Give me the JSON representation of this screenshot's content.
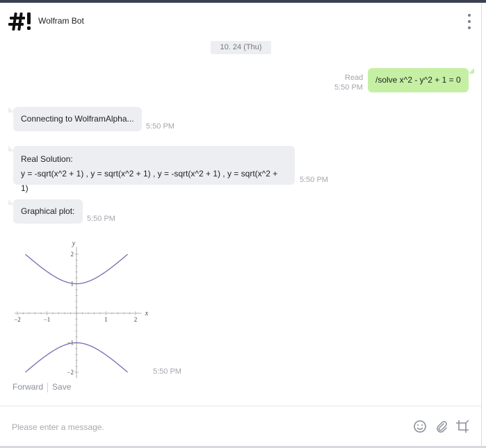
{
  "header": {
    "title": "Wolfram Bot",
    "logo_icon": "hashtag-exclaim-logo-icon",
    "menu_icon": "more-vertical-icon"
  },
  "date_divider": "10. 24 (Thu)",
  "messages": {
    "user_message": {
      "text": "/solve x^2 - y^2 + 1 = 0",
      "status": "Read",
      "time": "5:50 PM"
    },
    "connecting": {
      "text": "Connecting to WolframAlpha...",
      "time": "5:50 PM"
    },
    "solution": {
      "heading": "Real Solution:",
      "text": "y = -sqrt(x^2 + 1) , y = sqrt(x^2 + 1) , y = -sqrt(x^2 + 1) , y = sqrt(x^2 + 1)",
      "time": "5:50 PM"
    },
    "plot_label": {
      "text": "Graphical plot:",
      "time": "5:50 PM"
    },
    "plot_image": {
      "time": "5:50 PM",
      "forward": "Forward",
      "save": "Save"
    }
  },
  "plot": {
    "x_axis_label": "x",
    "y_axis_label": "y",
    "x_ticks": [
      "−2",
      "−1",
      "1",
      "2"
    ],
    "y_ticks": [
      "2",
      "1",
      "−1",
      "−2"
    ],
    "curve_color": "#6f6bb0"
  },
  "chart_data": {
    "type": "line",
    "title": "",
    "xlabel": "x",
    "ylabel": "y",
    "xlim": [
      -2,
      2
    ],
    "ylim": [
      -2,
      2
    ],
    "series": [
      {
        "x": [
          -1.73,
          -1.5,
          -1,
          -0.5,
          0,
          0.5,
          1,
          1.5,
          1.73
        ],
        "y": [
          2.0,
          1.8,
          1.414,
          1.118,
          1.0,
          1.118,
          1.414,
          1.8,
          2.0
        ]
      },
      {
        "x": [
          -1.73,
          -1.5,
          -1,
          -0.5,
          0,
          0.5,
          1,
          1.5,
          1.73
        ],
        "y": [
          -2.0,
          -1.8,
          -1.414,
          -1.118,
          -1.0,
          -1.118,
          -1.414,
          -1.8,
          -2.0
        ]
      }
    ]
  },
  "composer": {
    "placeholder": "Please enter a message.",
    "emoji_icon": "smiley-face-icon",
    "attach_icon": "paperclip-icon",
    "crop_icon": "crop-icon"
  },
  "colors": {
    "outgoing_bubble": "#c5f0a4",
    "incoming_bubble": "#edeef2"
  }
}
